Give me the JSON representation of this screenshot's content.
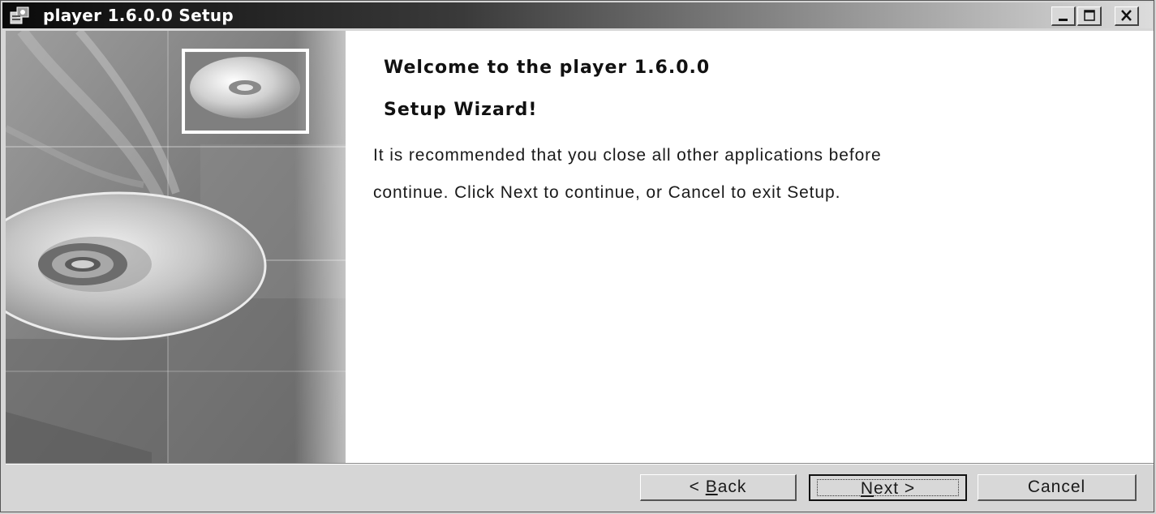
{
  "window": {
    "title": "player 1.6.0.0 Setup",
    "controls": {
      "minimize_icon": "minimize-icon",
      "maximize_icon": "maximize-icon",
      "close_icon": "close-icon"
    },
    "app_icon": "installer-icon"
  },
  "banner": {
    "image": "cd-disc-banner"
  },
  "content": {
    "heading_line1": "Welcome to the player 1.6.0.0",
    "heading_line2": "Setup Wizard!",
    "body_line1": "It is recommended that you close all other applications before",
    "body_line2": "continue. Click Next to continue, or Cancel to exit Setup."
  },
  "buttons": {
    "back_prefix": "< ",
    "back_mnemonic": "B",
    "back_rest": "ack",
    "next_mnemonic": "N",
    "next_rest": "ext >",
    "cancel_label": "Cancel"
  },
  "colors": {
    "titlebar_start": "#0a0a0a",
    "titlebar_end": "#dcdcdc",
    "content_background": "#ffffff",
    "window_background": "#d6d6d6"
  }
}
